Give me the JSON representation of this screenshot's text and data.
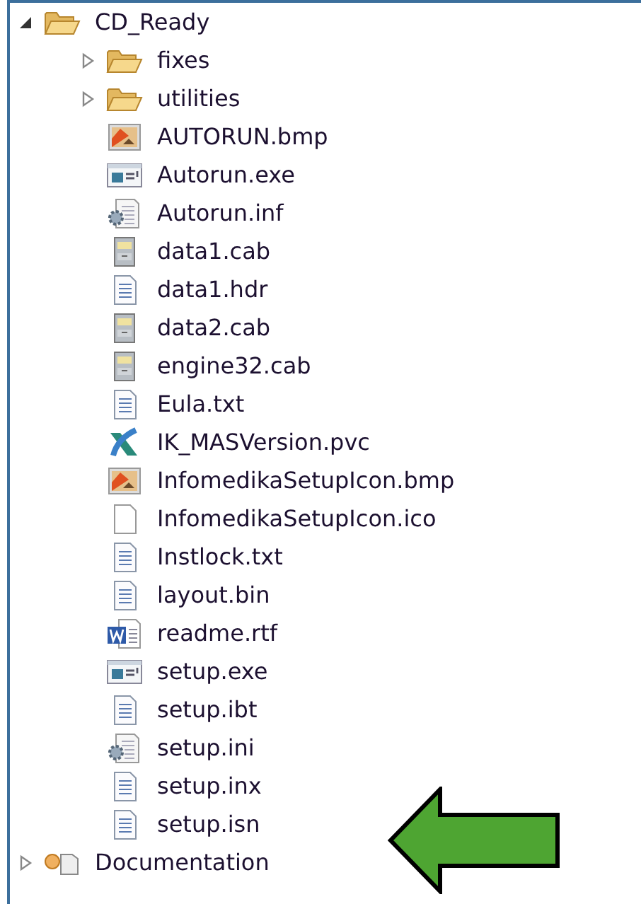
{
  "tree": [
    {
      "name": "CD_Ready",
      "kind": "folder",
      "expanded": true,
      "children": [
        {
          "name": "fixes",
          "kind": "folder",
          "expanded": false
        },
        {
          "name": "utilities",
          "kind": "folder",
          "expanded": false
        },
        {
          "name": "AUTORUN.bmp",
          "kind": "image"
        },
        {
          "name": "Autorun.exe",
          "kind": "app"
        },
        {
          "name": "Autorun.inf",
          "kind": "settings"
        },
        {
          "name": "data1.cab",
          "kind": "cabinet"
        },
        {
          "name": "data1.hdr",
          "kind": "text"
        },
        {
          "name": "data2.cab",
          "kind": "cabinet"
        },
        {
          "name": "engine32.cab",
          "kind": "cabinet"
        },
        {
          "name": "Eula.txt",
          "kind": "text"
        },
        {
          "name": "IK_MASVersion.pvc",
          "kind": "pvc"
        },
        {
          "name": "InfomedikaSetupIcon.bmp",
          "kind": "image"
        },
        {
          "name": "InfomedikaSetupIcon.ico",
          "kind": "blank"
        },
        {
          "name": "Instlock.txt",
          "kind": "text"
        },
        {
          "name": "layout.bin",
          "kind": "text"
        },
        {
          "name": "readme.rtf",
          "kind": "word"
        },
        {
          "name": "setup.exe",
          "kind": "app"
        },
        {
          "name": "setup.ibt",
          "kind": "text"
        },
        {
          "name": "setup.ini",
          "kind": "settings"
        },
        {
          "name": "setup.inx",
          "kind": "text"
        },
        {
          "name": "setup.isn",
          "kind": "text"
        }
      ]
    },
    {
      "name": "Documentation",
      "kind": "project",
      "expanded": false
    }
  ]
}
